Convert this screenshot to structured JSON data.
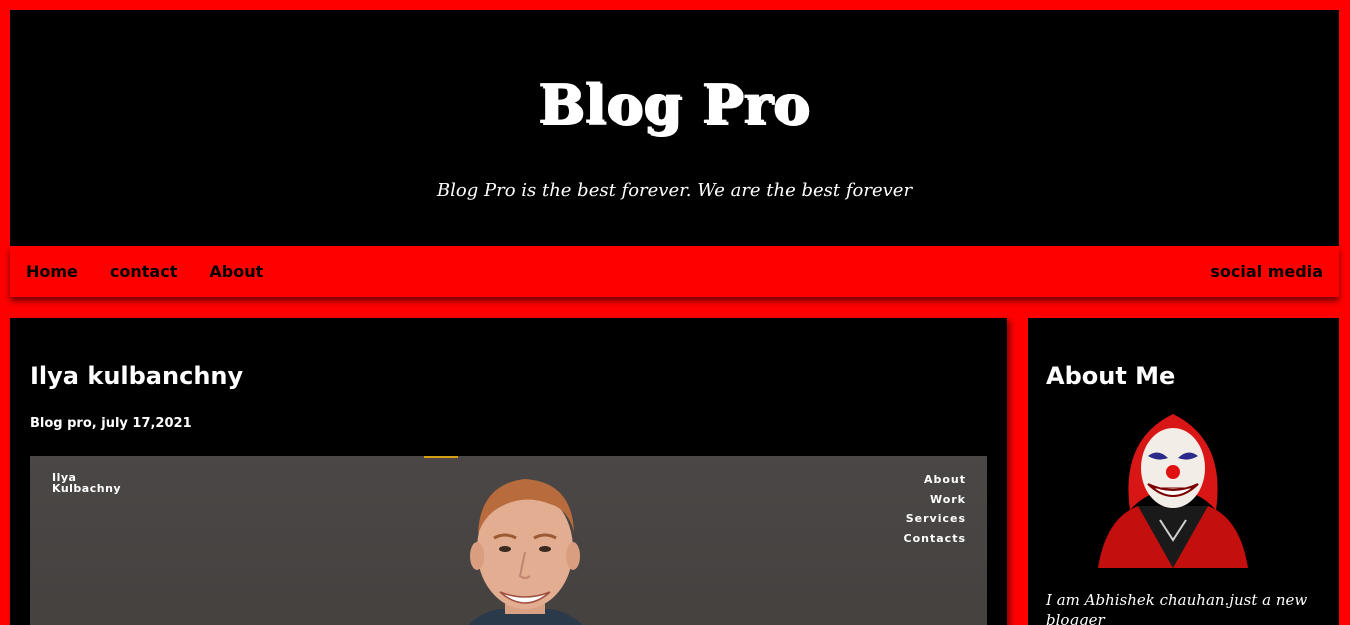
{
  "header": {
    "title": "Blog Pro",
    "tagline": "Blog Pro is the best forever. We are the best forever"
  },
  "nav": {
    "items": [
      {
        "label": "Home"
      },
      {
        "label": "contact"
      },
      {
        "label": "About"
      }
    ],
    "social_label": "social media"
  },
  "post": {
    "title": "Ilya kulbanchny",
    "meta": "Blog pro, july 17,2021",
    "image": {
      "name_line1": "Ilya",
      "name_line2": "Kulbachny",
      "menu": [
        "About",
        "Work",
        "Services",
        "Contacts"
      ]
    }
  },
  "sidebar": {
    "title": "About Me",
    "about_text": "I am Abhishek chauhan.just a new blogger"
  },
  "colors": {
    "background": "#ff0000",
    "panel": "#000000",
    "text": "#ffffff",
    "nav_text": "#000000"
  }
}
